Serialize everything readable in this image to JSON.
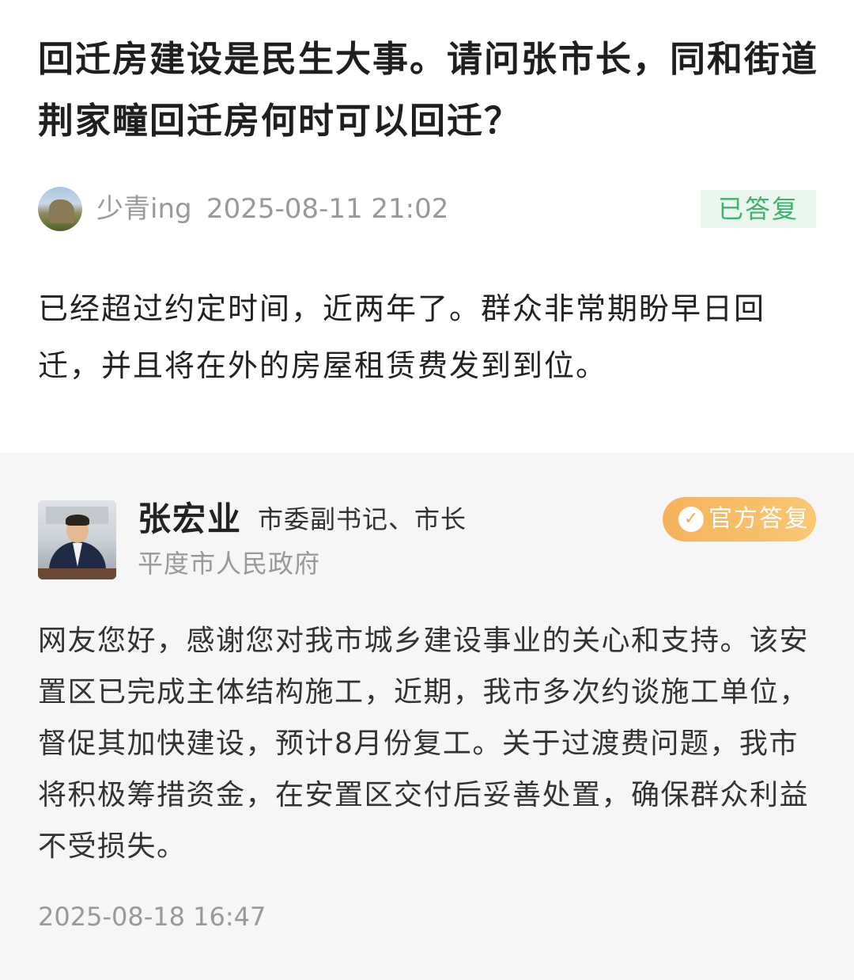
{
  "question": {
    "title": "回迁房建设是民生大事。请问张市长，同和街道荆家疃回迁房何时可以回迁？",
    "asker_name": "少青ing",
    "asker_avatar_icon": "landscape-avatar-icon",
    "time": "2025-08-11 21:02",
    "status": "已答复",
    "status_color": "#3fb36b",
    "body": "已经超过约定时间，近两年了。群众非常期盼早日回迁，并且将在外的房屋租赁费发到到位。"
  },
  "answer": {
    "official_name": "张宏业",
    "official_title": "市委副书记、市长",
    "organization": "平度市人民政府",
    "badge_label": "官方答复",
    "badge_icon": "verified-check-icon",
    "badge_color": "#f6b25a",
    "body": "网友您好，感谢您对我市城乡建设事业的关心和支持。该安置区已完成主体结构施工，近期，我市多次约谈施工单位，督促其加快建设，预计8月份复工。关于过渡费问题，我市将积极筹措资金，在安置区交付后妥善处置，确保群众利益不受损失。",
    "time": "2025-08-18 16:47"
  }
}
